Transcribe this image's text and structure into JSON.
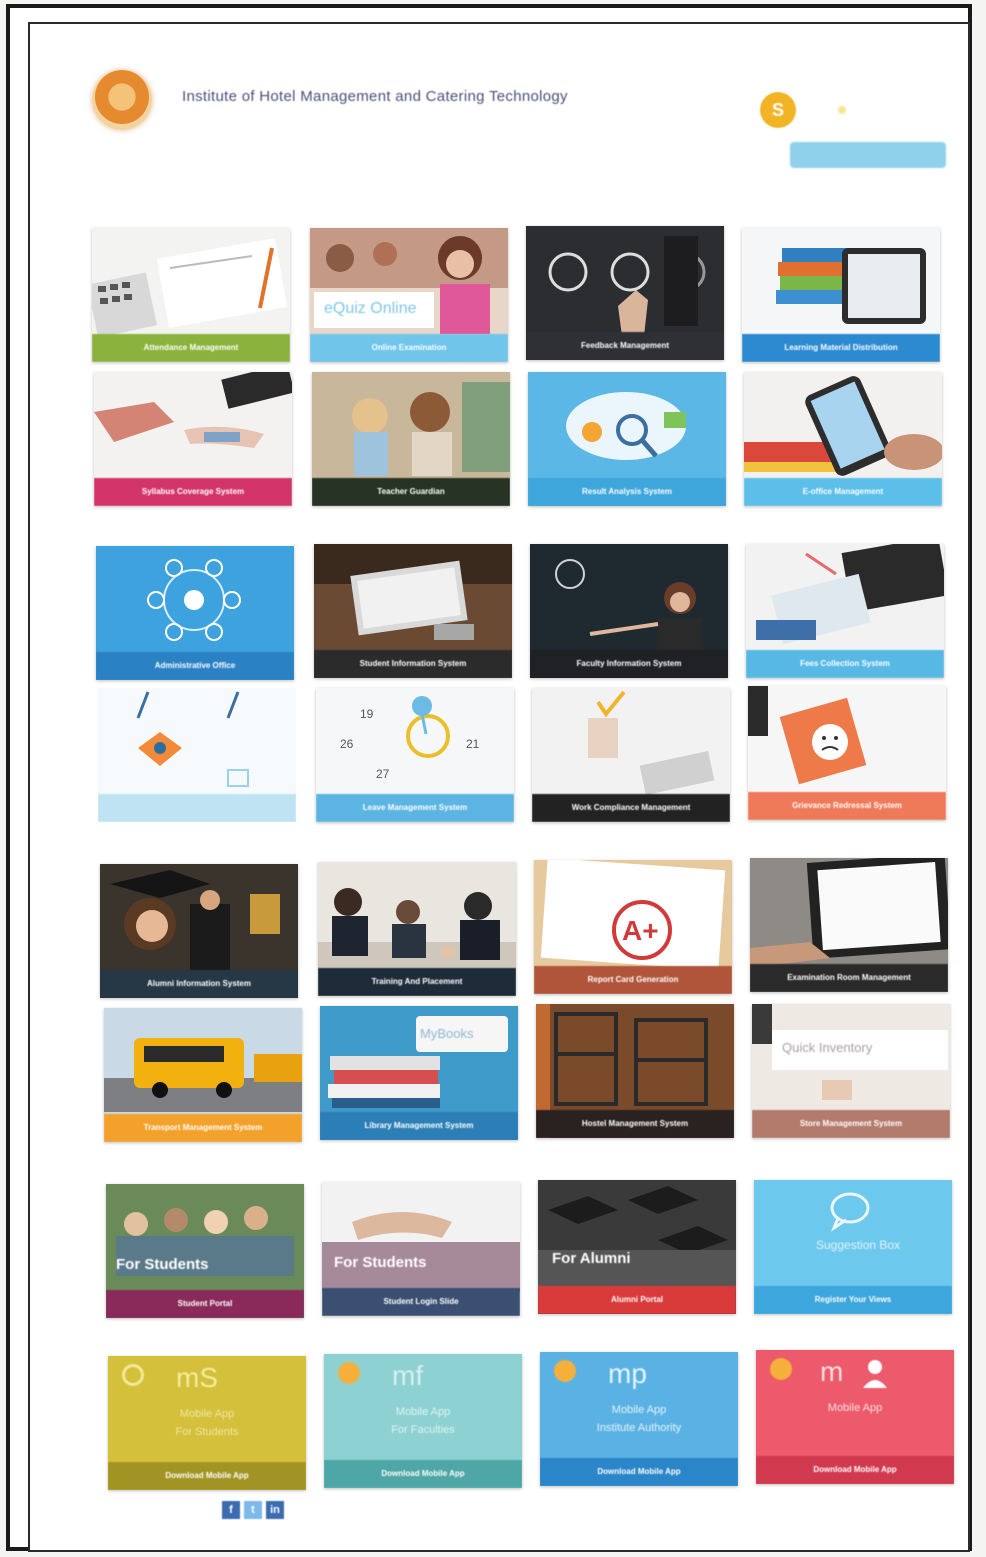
{
  "header": {
    "title": "Institute of Hotel Management and Catering Technology",
    "top_link": "",
    "coin_letter": "S",
    "nav_links": "",
    "nav_button": ""
  },
  "sections": {
    "academic": "",
    "administrative": "",
    "other": "",
    "student": "",
    "mobile": ""
  },
  "tiles": {
    "attendance": "Attendance Management",
    "online_exam": "Online Examination",
    "online_exam_overlay": "eQuiz Online",
    "feedback": "Feedback Management",
    "learning": "Learning Material Distribution",
    "syllabus": "Syllabus Coverage System",
    "teacher": "Teacher Guardian",
    "result": "Result Analysis System",
    "e_office": "E-office Management",
    "admin_office": "Administrative Office",
    "student_info": "Student Information System",
    "faculty_info": "Faculty Information System",
    "fees": "Fees Collection System",
    "virtual": "",
    "leave": "Leave Management System",
    "work": "Work Compliance Management",
    "grievance": "Grievance Redressal System",
    "alumni_info": "Alumni Information System",
    "training": "Training And Placement",
    "report_card": "Report Card Generation",
    "exam_room": "Examination Room Management",
    "transport": "Transport Management System",
    "library": "Library Management System",
    "library_overlay": "MyBooks",
    "hostel": "Hostel Management System",
    "store": "Store Management System",
    "store_overlay": "Quick Inventory",
    "student_portal": "Student Portal",
    "student_portal_overlay": "For Students",
    "student_login": "Student Login Slide",
    "student_login_overlay": "For Students",
    "alumni_portal": "Alumni Portal",
    "alumni_portal_overlay": "For Alumni",
    "suggestion": "Register Your Views",
    "suggestion_overlay": "Suggestion Box"
  },
  "apps": [
    {
      "code": "mS",
      "line1": "Mobile App",
      "line2": "For Students",
      "cap": "Download Mobile App",
      "color": "#d4c03a"
    },
    {
      "code": "mf",
      "line1": "Mobile App",
      "line2": "For Faculties",
      "cap": "Download Mobile App",
      "color": "#8ed1d2"
    },
    {
      "code": "mp",
      "line1": "Mobile App",
      "line2": "Institute Authority",
      "cap": "Download Mobile App",
      "color": "#5ab2e4"
    },
    {
      "code": "m",
      "line1": "Mobile App",
      "line2": "",
      "cap": "Download Mobile App",
      "color": "#ec5a6b"
    }
  ],
  "social": [
    "f",
    "t",
    "in"
  ],
  "icons": {
    "logo": "institute-logo-icon",
    "coin": "coin-icon",
    "chat": "chat-bubble-icon",
    "person": "person-icon"
  }
}
